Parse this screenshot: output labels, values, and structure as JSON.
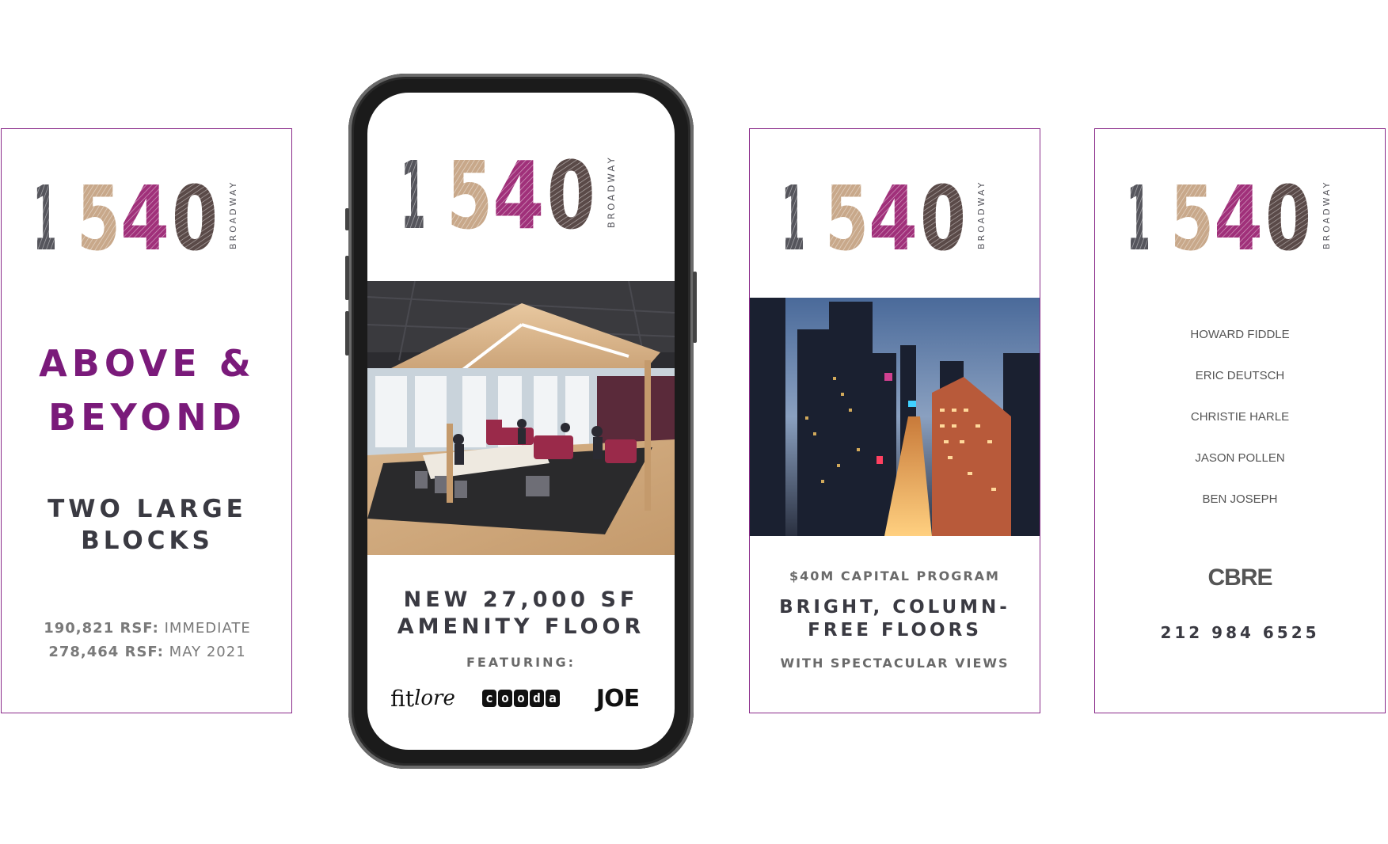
{
  "logo": {
    "number": "1540",
    "street": "BROADWAY"
  },
  "colors": {
    "accent": "#7a1a7a",
    "dark_text": "#3a3a42",
    "gray_text": "#6a6a6a",
    "border": "#8a2a8a"
  },
  "card1": {
    "headline": [
      "ABOVE &",
      "BEYOND"
    ],
    "sub": [
      "TWO LARGE",
      "BLOCKS"
    ],
    "rsf": [
      {
        "amount": "190,821 RSF:",
        "status": "IMMEDIATE"
      },
      {
        "amount": "278,464 RSF:",
        "status": "MAY 2021"
      }
    ]
  },
  "phone": {
    "title": [
      "NEW 27,000 SF",
      "AMENITY FLOOR"
    ],
    "featuring": "FEATURING:",
    "brands": {
      "fit": "fit",
      "lore": "lore",
      "cooda": [
        "c",
        "o",
        "o",
        "d",
        "a"
      ],
      "joe": "JOE"
    }
  },
  "card3": {
    "capital": "$40M CAPITAL PROGRAM",
    "title": [
      "BRIGHT, COLUMN-",
      "FREE FLOORS"
    ],
    "views": "WITH SPECTACULAR VIEWS"
  },
  "card4": {
    "contacts": [
      "HOWARD FIDDLE",
      "ERIC DEUTSCH",
      "CHRISTIE HARLE",
      "JASON POLLEN",
      "BEN JOSEPH"
    ],
    "company": "CBRE",
    "phone": "212 984 6525"
  }
}
